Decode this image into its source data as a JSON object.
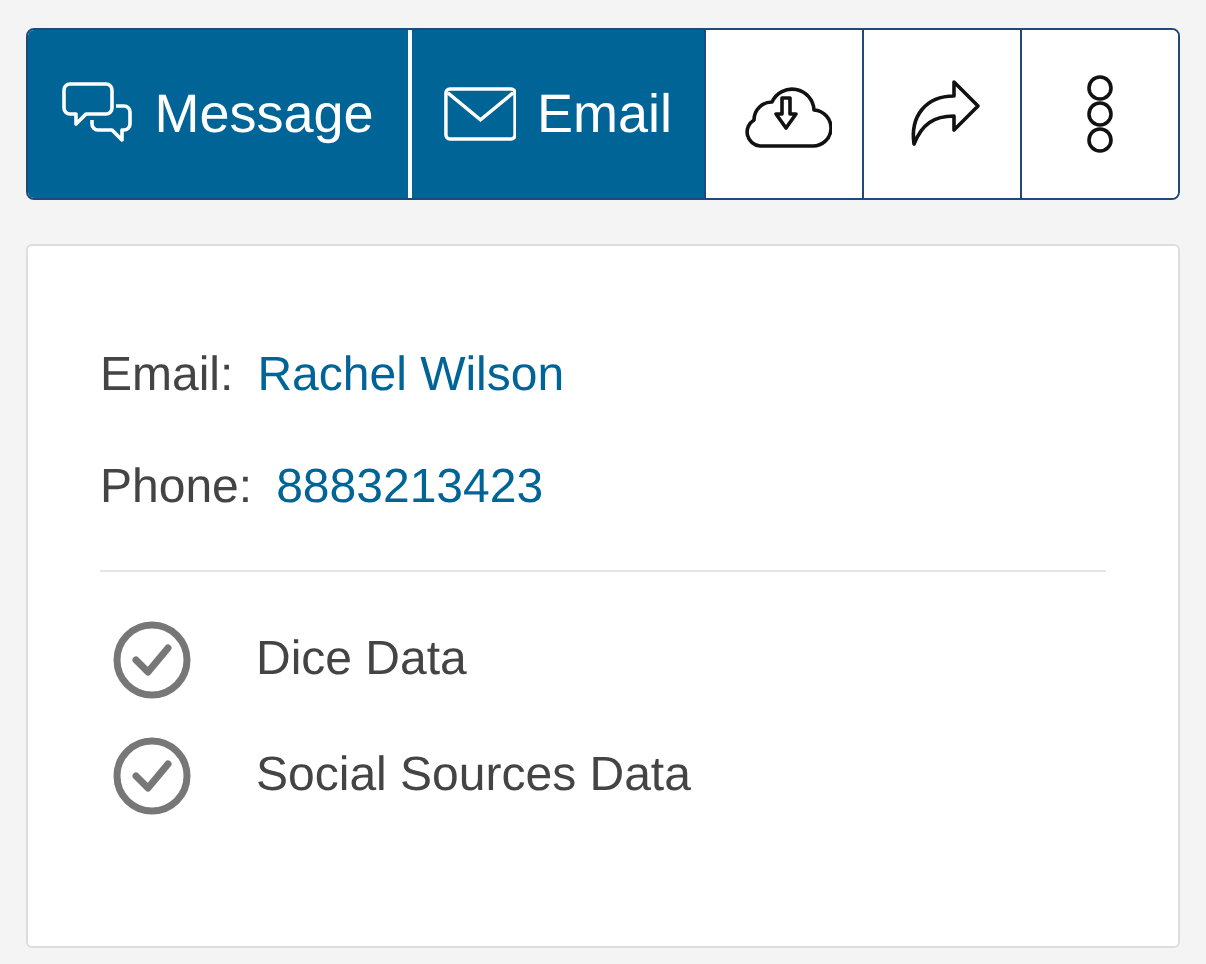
{
  "toolbar": [
    {
      "kind": "message",
      "label": "Message"
    },
    {
      "kind": "email",
      "label": "Email"
    },
    {
      "kind": "download"
    },
    {
      "kind": "share"
    },
    {
      "kind": "more"
    }
  ],
  "contact": [
    {
      "label": "Email:",
      "value": "Rachel Wilson"
    },
    {
      "label": "Phone:",
      "value": "8883213423"
    }
  ],
  "sources": [
    {
      "label": "Dice Data",
      "checked": true
    },
    {
      "label": "Social Sources Data",
      "checked": true
    }
  ]
}
